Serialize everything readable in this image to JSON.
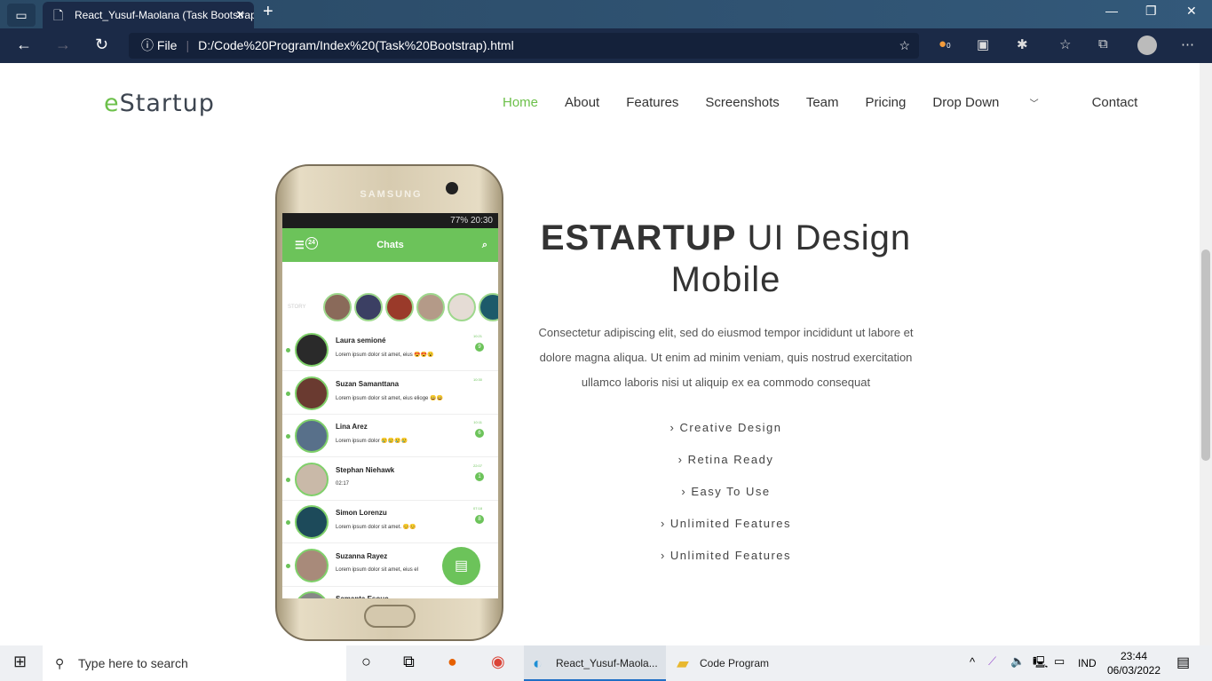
{
  "browser": {
    "tab_title": "React_Yusuf-Maolana (Task Bootstrap)",
    "url_prefix": "File",
    "url": "D:/Code%20Program/Index%20(Task%20Bootstrap).html",
    "ext_badge": "0"
  },
  "site": {
    "logo_e": "e",
    "logo_rest": "Startup",
    "menu": [
      "Home",
      "About",
      "Features",
      "Screenshots",
      "Team",
      "Pricing",
      "Drop Down",
      "Contact"
    ],
    "title_bold": "ESTARTUP",
    "title_rest": " UI Design Mobile",
    "description": "Consectetur adipiscing elit, sed do eiusmod tempor incididunt ut labore et dolore magna aliqua. Ut enim ad minim veniam, quis nostrud exercitation ullamco laboris nisi ut aliquip ex ea commodo consequat",
    "features": [
      "Creative Design",
      "Retina Ready",
      "Easy To Use",
      "Unlimited Features",
      "Unlimited Features"
    ]
  },
  "phone": {
    "brand": "SAMSUNG",
    "status": "77% 20:30",
    "header": "Chats",
    "badge": "24",
    "story_label": "STORY",
    "chats": [
      {
        "name": "Laura semioné",
        "msg": "Lorem ipsum dolor sit amet, eius 😍😍😮",
        "time": "10:21",
        "count": "9"
      },
      {
        "name": "Suzan Samanttana",
        "msg": "Lorem ipsum dolor sit amet, eius elioge 😀😀",
        "time": "10:30",
        "count": ""
      },
      {
        "name": "Lina Arez",
        "msg": "Lorem ipsum dolor 😢😢😢😢",
        "time": "10:11",
        "count": "6"
      },
      {
        "name": "Stephan Niehawk",
        "msg": "02:17",
        "time": "22:07",
        "count": "1"
      },
      {
        "name": "Simon Lorenzu",
        "msg": "Lorem ipsum dolor sit amet. 😊😊",
        "time": "07:18",
        "count": "8"
      },
      {
        "name": "Suzanna Rayez",
        "msg": "Lorem ipsum dolor sit amet, eius el",
        "time": "",
        "count": ""
      },
      {
        "name": "Samanta Esouc",
        "msg": "",
        "time": "",
        "count": ""
      }
    ]
  },
  "taskbar": {
    "search_placeholder": "Type here to search",
    "apps": [
      "React_Yusuf-Maola...",
      "Code Program"
    ],
    "lang": "IND",
    "time": "23:44",
    "date": "06/03/2022"
  }
}
